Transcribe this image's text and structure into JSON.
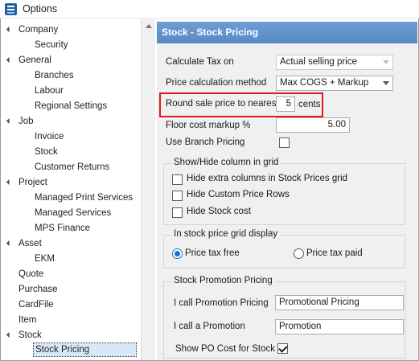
{
  "window": {
    "title": "Options"
  },
  "tree": {
    "items": [
      {
        "label": "Company",
        "level": 0,
        "expanded": true
      },
      {
        "label": "Security",
        "level": 1
      },
      {
        "label": "General",
        "level": 0,
        "expanded": true
      },
      {
        "label": "Branches",
        "level": 1
      },
      {
        "label": "Labour",
        "level": 1
      },
      {
        "label": "Regional Settings",
        "level": 1
      },
      {
        "label": "Job",
        "level": 0,
        "expanded": true
      },
      {
        "label": "Invoice",
        "level": 1
      },
      {
        "label": "Stock",
        "level": 1
      },
      {
        "label": "Customer Returns",
        "level": 1
      },
      {
        "label": "Project",
        "level": 0,
        "expanded": true
      },
      {
        "label": "Managed Print Services",
        "level": 1
      },
      {
        "label": "Managed Services",
        "level": 1
      },
      {
        "label": "MPS Finance",
        "level": 1
      },
      {
        "label": "Asset",
        "level": 0,
        "expanded": true
      },
      {
        "label": "EKM",
        "level": 1
      },
      {
        "label": "Quote",
        "level": 0
      },
      {
        "label": "Purchase",
        "level": 0
      },
      {
        "label": "CardFile",
        "level": 0
      },
      {
        "label": "Item",
        "level": 0
      },
      {
        "label": "Stock",
        "level": 0,
        "expanded": true
      },
      {
        "label": "Stock Pricing",
        "level": 1,
        "selected": true
      }
    ]
  },
  "panel": {
    "title": "Stock - Stock Pricing",
    "calc_tax": {
      "label": "Calculate Tax on",
      "value": "Actual selling price"
    },
    "price_method": {
      "label": "Price calculation method",
      "value": "Max COGS + Markup"
    },
    "round": {
      "label": "Round sale price to nearest",
      "value": "5",
      "unit": "cents"
    },
    "floor": {
      "label": "Floor cost markup %",
      "value": "5.00"
    },
    "branch_pricing": {
      "label": "Use Branch Pricing",
      "checked": false
    },
    "show_hide": {
      "title": "Show/Hide column in grid",
      "options": [
        {
          "label": "Hide extra columns in Stock Prices grid",
          "checked": false
        },
        {
          "label": "Hide Custom Price Rows",
          "checked": false
        },
        {
          "label": "Hide Stock cost",
          "checked": false
        }
      ]
    },
    "grid_display": {
      "title": "In stock price grid display",
      "tax_free": "Price tax free",
      "tax_paid": "Price tax paid",
      "selected": "tax_free"
    },
    "promotion": {
      "title": "Stock Promotion Pricing",
      "pricing": {
        "label": "I call Promotion Pricing",
        "value": "Promotional Pricing"
      },
      "promo": {
        "label": "I call a Promotion",
        "value": "Promotion"
      },
      "show_po_cost": {
        "label": "Show PO Cost for Stock",
        "checked": true
      }
    }
  },
  "colors": {
    "header": "#5f8fca",
    "highlight": "#d91c1c",
    "selection": "#d9e8f8",
    "radio": "#1f6fd1"
  }
}
